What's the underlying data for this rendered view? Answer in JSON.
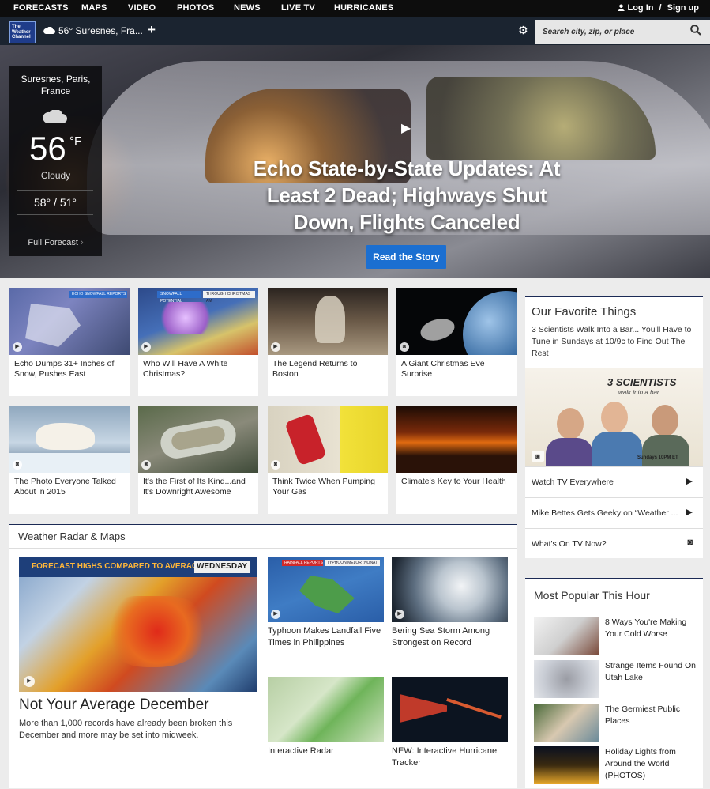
{
  "nav": {
    "items": [
      "FORECASTS",
      "MAPS",
      "VIDEO",
      "PHOTOS",
      "NEWS",
      "LIVE TV",
      "HURRICANES"
    ],
    "login": "Log In",
    "separator": "/",
    "signup": "Sign up"
  },
  "locbar": {
    "logo_text": [
      "The",
      "Weather",
      "Channel"
    ],
    "location": "56° Suresnes, Fra...",
    "search_placeholder": "Search city, zip, or place"
  },
  "hero": {
    "headline": "Echo State-by-State Updates: At Least 2 Dead; Highways Shut Down, Flights Canceled",
    "button": "Read the Story"
  },
  "weather": {
    "city": "Suresnes, Paris, France",
    "temp": "56",
    "unit": "°F",
    "condition": "Cloudy",
    "hilo": "58° / 51°",
    "full_forecast": "Full Forecast"
  },
  "cards": [
    {
      "caption": "Echo Dumps 31+ Inches of Snow, Pushes East",
      "badge": "play"
    },
    {
      "caption": "Who Will Have A White Christmas?",
      "badge": "play"
    },
    {
      "caption": "The Legend Returns to Boston",
      "badge": "play"
    },
    {
      "caption": "A Giant Christmas Eve Surprise",
      "badge": "camera"
    },
    {
      "caption": "The Photo Everyone Talked About in 2015",
      "badge": "camera"
    },
    {
      "caption": "It's the First of Its Kind...and It's Downright Awesome",
      "badge": "camera"
    },
    {
      "caption": "Think Twice When Pumping Your Gas",
      "badge": "camera"
    },
    {
      "caption": "Climate's Key to Your Health",
      "badge": ""
    }
  ],
  "card_overlays": {
    "c1": [
      "ECHO SNOWFALL REPORTS"
    ],
    "c2": [
      "SNOWFALL POTENTIAL",
      "THROUGH CHRISTMAS AM"
    ]
  },
  "radar": {
    "title": "Weather Radar & Maps",
    "big_title": "Not Your Average December",
    "big_desc": "More than 1,000 records have already been broken this December and more may be set into midweek.",
    "map_header": "FORECAST HIGHS COMPARED TO AVERAGE",
    "map_day": "WEDNESDAY",
    "minis": [
      {
        "caption": "Typhoon Makes Landfall Five Times in Philippines",
        "overlay": [
          "RAINFALL REPORTS",
          "TYPHOON MELOR (NONA)"
        ]
      },
      {
        "caption": "Bering Sea Storm Among Strongest on Record"
      },
      {
        "caption": "Interactive Radar"
      },
      {
        "caption": "NEW: Interactive Hurricane Tracker"
      }
    ]
  },
  "favorites": {
    "title": "Our Favorite Things",
    "desc": "3 Scientists Walk Into a Bar... You'll Have to Tune in Sundays at 10/9c to Find Out The Rest",
    "promo_title": "3 SCIENTISTS",
    "promo_sub": "walk into a bar",
    "promo_time": "Sundays 10PM ET",
    "links": [
      {
        "label": "Watch TV Everywhere",
        "icon": "play-icon"
      },
      {
        "label": "Mike Bettes Gets Geeky on “Weather ...",
        "icon": "play-icon"
      },
      {
        "label": "What's On TV Now?",
        "icon": "camera-icon"
      }
    ]
  },
  "popular": {
    "title": "Most Popular This Hour",
    "items": [
      "8 Ways You're Making Your Cold Worse",
      "Strange Items Found On Utah Lake",
      "The Germiest Public Places",
      "Holiday Lights from Around the World (PHOTOS)"
    ]
  },
  "colors": {
    "accent": "#1b6fd1",
    "nav_bg": "#0d0d0d",
    "locbar_bg": "#1b2430",
    "section_rule": "#1b2a55"
  }
}
